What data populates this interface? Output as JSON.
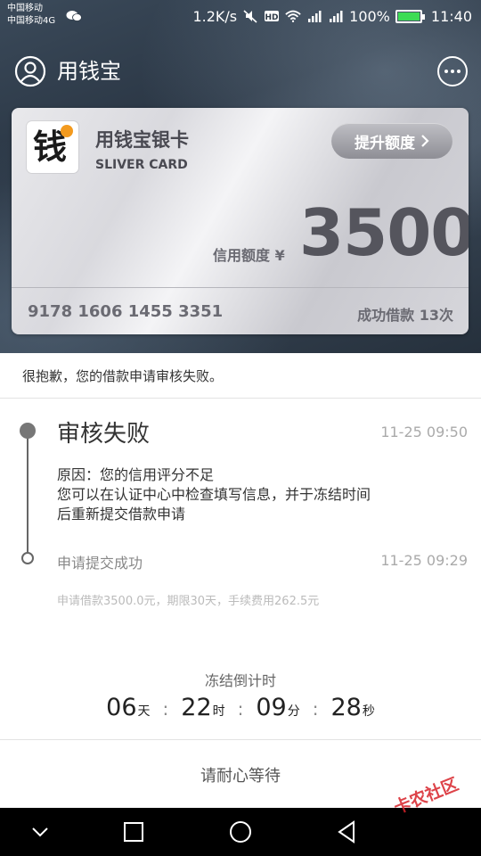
{
  "status_bar": {
    "carrier1": "中国移动",
    "carrier2": "中国移动4G",
    "speed": "1.2K/s",
    "battery": "100%",
    "time": "11:40"
  },
  "app_bar": {
    "title": "用钱宝"
  },
  "card": {
    "logo_char": "钱",
    "name": "用钱宝银卡",
    "subtitle": "SLIVER CARD",
    "raise_label": "提升额度",
    "limit_label": "信用额度 ¥",
    "limit_value": "3500",
    "number": "9178 1606 1455 3351",
    "loan_count": "成功借款 13次"
  },
  "notice": "很抱歉，您的借款申请审核失败。",
  "timeline": {
    "status_title": "审核失败",
    "status_time": "11-25 09:50",
    "reason_line1": "原因：您的信用评分不足",
    "reason_line2": "您可以在认证中心中检查填写信息，并于冻结时间后重新提交借款申请",
    "submit_label": "申请提交成功",
    "submit_time": "11-25 09:29",
    "detail": "申请借款3500.0元，期限30天，手续费用262.5元"
  },
  "countdown": {
    "title": "冻结倒计时",
    "days": "06",
    "days_unit": "天",
    "hours": "22",
    "hours_unit": "时",
    "minutes": "09",
    "minutes_unit": "分",
    "seconds": "28",
    "seconds_unit": "秒",
    "sep": ":"
  },
  "footer": {
    "wait_text": "请耐心等待"
  },
  "watermark": "卡农社区",
  "colors": {
    "accent_orange": "#f39a1e",
    "battery_green": "#3ddc55",
    "watermark_red": "#d8232a"
  }
}
